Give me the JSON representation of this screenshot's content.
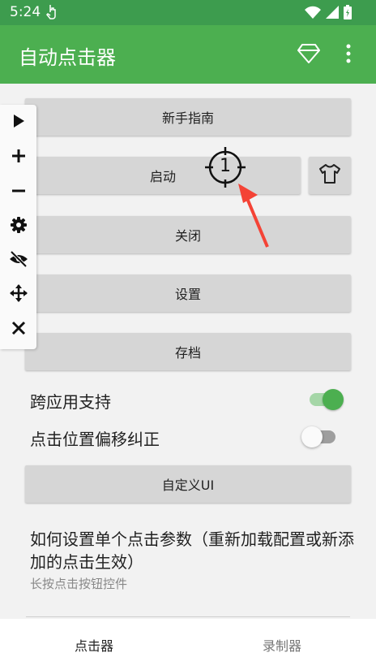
{
  "status_bar": {
    "time": "5:24"
  },
  "app_bar": {
    "title": "自动点击器"
  },
  "buttons": {
    "guide": "新手指南",
    "start": "启动",
    "close": "关闭",
    "settings": "设置",
    "save": "存档",
    "custom_ui": "自定义UI"
  },
  "click_target": {
    "number": "1"
  },
  "options": [
    {
      "label": "跨应用支持",
      "enabled": true
    },
    {
      "label": "点击位置偏移纠正",
      "enabled": false
    }
  ],
  "help": {
    "title": "如何设置单个点击参数（重新加载配置或新添加的点击生效）",
    "subtitle": "长按点击按钮控件"
  },
  "bottom_nav": {
    "tabs": [
      "点击器",
      "录制器"
    ],
    "active_index": 0
  },
  "colors": {
    "primary": "#4caf50",
    "status_bar": "#3d9c4e",
    "arrow": "#f44336"
  }
}
